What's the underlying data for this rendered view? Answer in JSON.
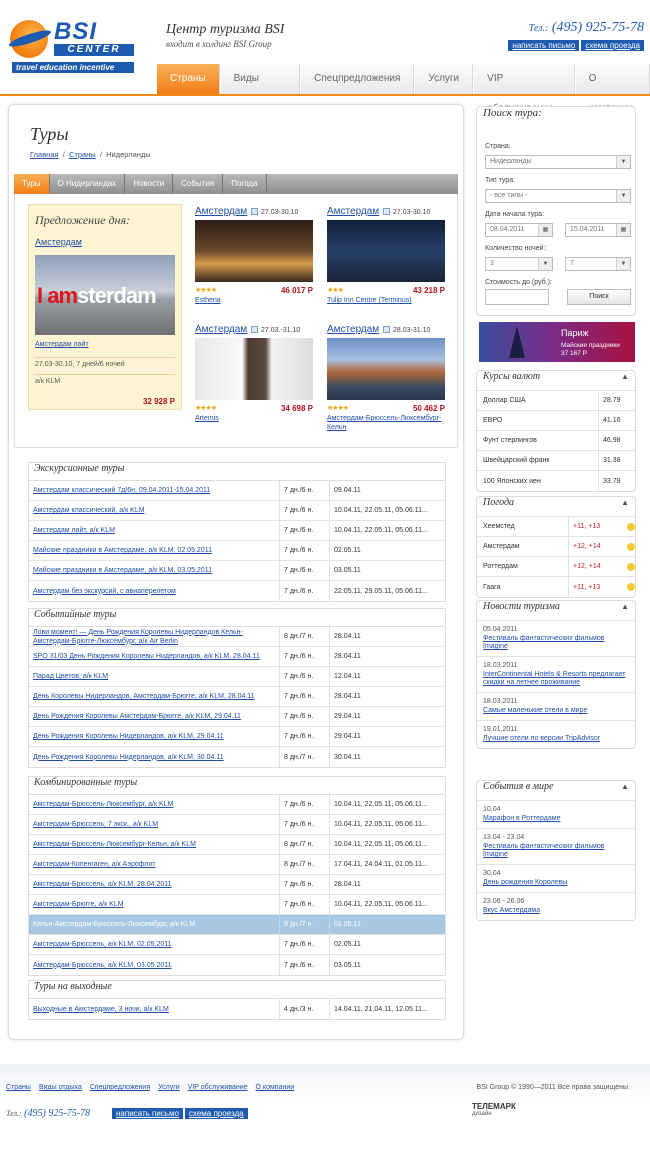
{
  "header": {
    "logo_bsi": "BSI",
    "logo_center": "CENTER",
    "logo_tagline": "travel education incentive",
    "title": "Центр туризма BSI",
    "subtitle": "входит в холдинг BSI Group",
    "phone_prefix": "Тел.:",
    "phone": "(495) 925-75-78",
    "links": [
      "написать письмо",
      "схема проезда"
    ]
  },
  "nav": {
    "items": [
      "Страны",
      "Виды отдыха",
      "Спецпредложения",
      "Услуги",
      "VIP обслуживание",
      "О компании"
    ],
    "active": 0
  },
  "page": {
    "title": "Туры",
    "breadcrumb": [
      "Главная",
      "Страны",
      "Нидерланды"
    ],
    "tabs": [
      "Туры",
      "О Нидерландах",
      "Новости",
      "События",
      "Погода"
    ]
  },
  "deal": {
    "title": "Предложение дня:",
    "city": "Амстердам",
    "image_text_red": "I am",
    "image_text": "sterdam",
    "name": "Амстердам лайт",
    "dates": "27.03-30.10, 7 дней/6 ночей",
    "airline": "а/к KLM",
    "price": "32 928 Р"
  },
  "cards": [
    {
      "title": "Амстердам",
      "dates": "27.03-30.10",
      "stars": "★★★★",
      "price": "46 017 Р",
      "hotel": "Estheria"
    },
    {
      "title": "Амстердам",
      "dates": "27.03-30.10",
      "stars": "★★★",
      "price": "43 218 Р",
      "hotel": "Tulip Inn Centre (Terminus)"
    },
    {
      "title": "Амстердам",
      "dates": "27.03.-31.10",
      "stars": "★★★★",
      "price": "34 698 Р",
      "hotel": "Artemis"
    },
    {
      "title": "Амстердам",
      "dates": "28.03-31.10",
      "stars": "★★★★",
      "price": "50 462 Р",
      "hotel": "Амстердам-Брюссель-Люксембург-Кельн"
    }
  ],
  "sections": [
    {
      "title": "Экскурсионные туры",
      "rows": [
        {
          "name": "Амстердам классический 7д/6н, 09.04.2011-15.04.2011",
          "dur": "7 дн./6 н.",
          "dates": "09.04.11"
        },
        {
          "name": "Амстердам классический, а/к KLM",
          "dur": "7 дн./6 н.",
          "dates": "10.04.11, 22.05.11, 05.06.11..."
        },
        {
          "name": "Амстердам лайт, а/к KLM",
          "dur": "7 дн./6 н.",
          "dates": "10.04.11, 22.05.11, 05.06.11..."
        },
        {
          "name": "Майские праздники в Амстердаме, а/к KLM, 02.05.2011",
          "dur": "7 дн./6 н.",
          "dates": "02.05.11"
        },
        {
          "name": "Майские праздники в Амстердаме, а/к KLM, 03.05.2011",
          "dur": "7 дн./6 н.",
          "dates": "03.05.11"
        },
        {
          "name": "Амстердам без экскурсий, с авиаперелетом",
          "dur": "7 дн./6 н.",
          "dates": "22.05.11, 29.05.11, 05.06.11..."
        }
      ]
    },
    {
      "title": "Событийные туры",
      "rows": [
        {
          "name": "Лови момент! — День Рождения Королевы Нидерландов Кельн-Амстердам-Брюгге-Люксембург, а/к Air Berlin",
          "dur": "8 дн./7 н.",
          "dates": "28.04.11"
        },
        {
          "name": "SPO 31/03 День Рождения Королевы Нидерландов, а/к KLM, 28.04.11",
          "dur": "7 дн./6 н.",
          "dates": "28.04.11"
        },
        {
          "name": "Парад Цветов, а/к KLM",
          "dur": "7 дн./6 н.",
          "dates": "12.04.11"
        },
        {
          "name": "День Королевы Нидерландов, Амстердам-Брюгге, а/к KLM, 28.04.11",
          "dur": "7 дн./6 н.",
          "dates": "28.04.11"
        },
        {
          "name": "День Рождения Королевы Амстердам-Брюгге, а/к KLM, 29.04.11",
          "dur": "7 дн./6 н.",
          "dates": "29.04.11"
        },
        {
          "name": "День Рождения Королевы Нидерландов, а/к KLM, 29.04.11",
          "dur": "7 дн./6 н.",
          "dates": "29.04.11"
        },
        {
          "name": "День Рождения Королевы Нидерландов, а/к KLM, 30.04.11",
          "dur": "8 дн./7 н.",
          "dates": "30.04.11"
        }
      ]
    },
    {
      "title": "Комбинированные туры",
      "rows": [
        {
          "name": "Амстердам-Брюссель-Люксембург, а/к KLM",
          "dur": "7 дн./6 н.",
          "dates": "10.04.11, 22.05.11, 05.06.11..."
        },
        {
          "name": "Амстердам-Брюссель, 7 экск., а/к KLM",
          "dur": "7 дн./6 н.",
          "dates": "10.04.11, 22.05.11, 05.06.11..."
        },
        {
          "name": "Амстердам-Брюссель-Люксембург-Кельн, а/к KLM",
          "dur": "8 дн./7 н.",
          "dates": "10.04.11, 22.05.11, 05.06.11..."
        },
        {
          "name": "Амстердам-Копенгаген, а/к Аэрофлот",
          "dur": "8 дн./7 н.",
          "dates": "17.04.11, 24.04.11, 01.05.11..."
        },
        {
          "name": "Амстердам-Брюссель, а/к KLM, 28.04.2011",
          "dur": "7 дн./6 н.",
          "dates": "28.04.11"
        },
        {
          "name": "Амстердам-Брюгге, а/к KLM",
          "dur": "7 дн./6 н.",
          "dates": "10.04.11, 22.05.11, 05.06.11..."
        },
        {
          "name": "Кельн-Амстердам-Брюссель-Люксембург, а/к KLM",
          "dur": "8 дн./7 н.",
          "dates": "01.05.11",
          "highlight": true
        },
        {
          "name": "Амстердам-Брюссель, а/к KLM, 02.05.2011",
          "dur": "7 дн./6 н.",
          "dates": "02.05.11"
        },
        {
          "name": "Амстердам-Брюссель, а/к KLM, 03.05.2011",
          "dur": "7 дн./6 н.",
          "dates": "03.05.11"
        }
      ]
    },
    {
      "title": "Туры на выходные",
      "rows": [
        {
          "name": "Выходные в Амстердаме, 3 ночи, а/к KLM",
          "dur": "4 дн./3 н.",
          "dates": "14.04.11, 21.04.11, 12.05.11..."
        }
      ]
    }
  ],
  "search": {
    "title": "Поиск тура:",
    "country_label": "Страна:",
    "country": "Нидерланды",
    "type_label": "Тип тура:",
    "type": "- все типы -",
    "date_label": "Дата начала тура:",
    "date_from": "08.04.2011",
    "date_to": "15.04.2011",
    "nights_label": "Количество ночей:",
    "nights_from": "3",
    "nights_to": "7",
    "cost_label": "Стоимость до (руб.):",
    "cost": "",
    "button": "Поиск"
  },
  "banner": {
    "title": "Париж",
    "text": "Майские праздники",
    "price": "37 167 Р"
  },
  "rates": {
    "title": "Курсы валют",
    "items": [
      {
        "name": "Доллар США",
        "value": "28.79"
      },
      {
        "name": "ЕВРО",
        "value": "41.16"
      },
      {
        "name": "Фунт стерлингов",
        "value": "46.98"
      },
      {
        "name": "Швейцарский франк",
        "value": "31.38"
      },
      {
        "name": "100 Японских иен",
        "value": "33.79"
      }
    ]
  },
  "weather": {
    "title": "Погода",
    "items": [
      {
        "city": "Хеемстед",
        "temp": "+11, +13"
      },
      {
        "city": "Амстердам",
        "temp": "+12, +14"
      },
      {
        "city": "Роттердам",
        "temp": "+12, +14"
      },
      {
        "city": "Гаага",
        "temp": "+11, +13"
      }
    ]
  },
  "news": {
    "title": "Новости туризма",
    "items": [
      {
        "date": "05.04.2011",
        "text": "Фестиваль фантастических фильмов Imagine"
      },
      {
        "date": "18.03.2011",
        "text": "InterContinental Hotels & Resorts предлагает скидки на летнее проживание"
      },
      {
        "date": "18.03.2011",
        "text": "Самые маленькие отели в мире"
      },
      {
        "date": "19.01.2011",
        "text": "Лучшие отели по версии TripAdvisor"
      }
    ]
  },
  "events": {
    "title": "События в мире",
    "items": [
      {
        "date": "10.04",
        "text": "Марафон в Роттердаме"
      },
      {
        "date": "13.04 - 23.04",
        "text": "Фестиваль фантастических фильмов Imagine"
      },
      {
        "date": "30.04",
        "text": "День рождения Королевы"
      },
      {
        "date": "23.06 - 26.06",
        "text": "Вкус Амстердама"
      }
    ]
  },
  "footer": {
    "nav": [
      "Страны",
      "Виды отдыха",
      "Спецпредложения",
      "Услуги",
      "VIP обслуживание",
      "О компании"
    ],
    "copyright": "BSI Group © 1990—2011 Все права защищены.",
    "phone_prefix": "Тел.:",
    "phone": "(495) 925-75-78",
    "links": [
      "написать письмо",
      "схема проезда"
    ],
    "studio": "ТЕЛЕМАРК",
    "studio_sub": "дизайн"
  }
}
